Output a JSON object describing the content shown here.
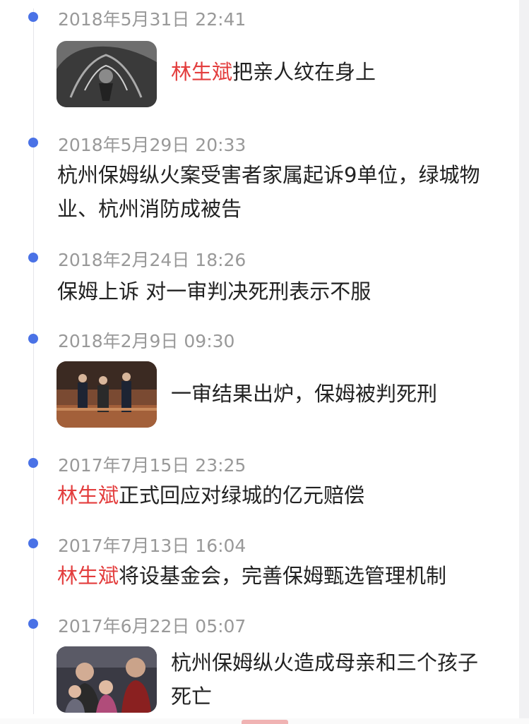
{
  "timeline": {
    "items": [
      {
        "time": "2018年5月31日 22:41",
        "highlight": "林生斌",
        "text": "把亲人纹在身上",
        "image": "tattoo-photo"
      },
      {
        "time": "2018年5月29日 20:33",
        "highlight": "",
        "text": "杭州保姆纵火案受害者家属起诉9单位，绿城物业、杭州消防成被告",
        "image": ""
      },
      {
        "time": "2018年2月24日 18:26",
        "highlight": "",
        "text": "保姆上诉 对一审判决死刑表示不服",
        "image": ""
      },
      {
        "time": "2018年2月9日 09:30",
        "highlight": "",
        "text": "一审结果出炉，保姆被判死刑",
        "image": "courtroom-photo"
      },
      {
        "time": "2017年7月15日 23:25",
        "highlight": "林生斌",
        "text": "正式回应对绿城的亿元赔偿",
        "image": ""
      },
      {
        "time": "2017年7月13日 16:04",
        "highlight": "林生斌",
        "text": "将设基金会，完善保姆甄选管理机制",
        "image": ""
      },
      {
        "time": "2017年6月22日 05:07",
        "highlight": "",
        "text": "杭州保姆纵火造成母亲和三个孩子死亡",
        "image": "family-photo"
      }
    ]
  }
}
